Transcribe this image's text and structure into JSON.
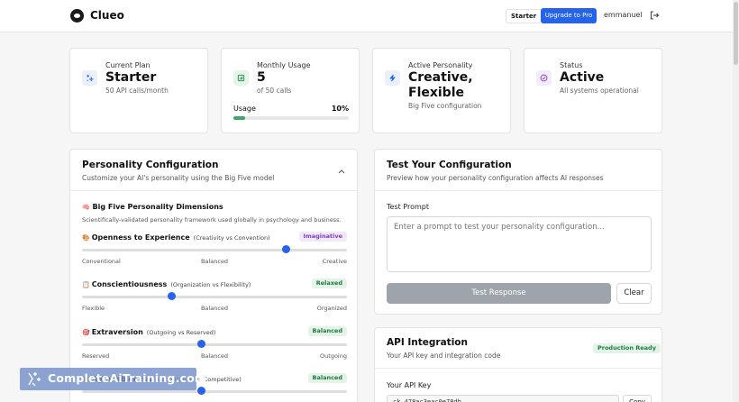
{
  "app": {
    "brand": "Clueo",
    "plan_chip": "Starter",
    "upgrade_label": "Upgrade to Pro",
    "username": "emmanuel"
  },
  "stats": {
    "plan": {
      "label": "Current Plan",
      "value": "Starter",
      "sub": "50 API calls/month",
      "icon": "sparkles-icon",
      "icon_bg": "#e9f0fb",
      "icon_color": "#2563eb"
    },
    "usage": {
      "label": "Monthly Usage",
      "value": "5",
      "sub": "of 50 calls",
      "bar_label": "Usage",
      "percent_text": "10%",
      "percent": 10,
      "icon": "chart-icon",
      "icon_bg": "#e6f5ea",
      "icon_color": "#2f9a57"
    },
    "personality": {
      "label": "Active Personality",
      "value": "Creative, Flexible",
      "sub": "Big Five configuration",
      "icon": "bolt-icon",
      "icon_bg": "#e9f0fb",
      "icon_color": "#2563eb"
    },
    "status": {
      "label": "Status",
      "value": "Active",
      "sub": "All systems operational",
      "icon": "check-circle-icon",
      "icon_bg": "#f2ebfa",
      "icon_color": "#8b4fc6"
    }
  },
  "config": {
    "title": "Personality Configuration",
    "subtitle": "Customize your AI's personality using the Big Five model",
    "dimensions_title": "Big Five Personality Dimensions",
    "dimensions_emoji": "🧠",
    "dimensions_sub": "Scientifically-validated personality framework used globally in psychology and business.",
    "traits": [
      {
        "emoji": "🎨",
        "name": "Openness to Experience",
        "range": "(Creativity vs Convention)",
        "badge": "Imaginative",
        "badge_bg": "#f1e8fb",
        "badge_color": "#7a3fb5",
        "value": 77,
        "low": "Conventional",
        "mid": "Balanced",
        "high": "Creative"
      },
      {
        "emoji": "📋",
        "name": "Conscientiousness",
        "range": "(Organization vs Flexibility)",
        "badge": "Relaxed",
        "badge_bg": "#e3f3e8",
        "badge_color": "#1f7a3e",
        "value": 34,
        "low": "Flexible",
        "mid": "Balanced",
        "high": "Organized"
      },
      {
        "emoji": "🎯",
        "name": "Extraversion",
        "range": "(Outgoing vs Reserved)",
        "badge": "Balanced",
        "badge_bg": "#e3f3e8",
        "badge_color": "#1f7a3e",
        "value": 45,
        "low": "Reserved",
        "mid": "Balanced",
        "high": "Outgoing"
      },
      {
        "emoji": "🤝",
        "name": "Agreeableness",
        "range": "(Cooperative vs Competitive)",
        "badge": "Balanced",
        "badge_bg": "#e3f3e8",
        "badge_color": "#1f7a3e",
        "value": 45,
        "low": "",
        "mid": "",
        "high": ""
      }
    ]
  },
  "test": {
    "title": "Test Your Configuration",
    "subtitle": "Preview how your personality configuration affects AI responses",
    "prompt_label": "Test Prompt",
    "prompt_placeholder": "Enter a prompt to test your personality configuration...",
    "test_label": "Test Response",
    "clear_label": "Clear"
  },
  "api": {
    "title": "API Integration",
    "subtitle": "Your API key and integration code",
    "badge": "Production Ready",
    "key_label": "Your API Key",
    "key_value": "ck_478ac3eac0e78db...",
    "copy_label": "Copy"
  },
  "watermark": {
    "text": "CompleteAiTraining.com"
  }
}
